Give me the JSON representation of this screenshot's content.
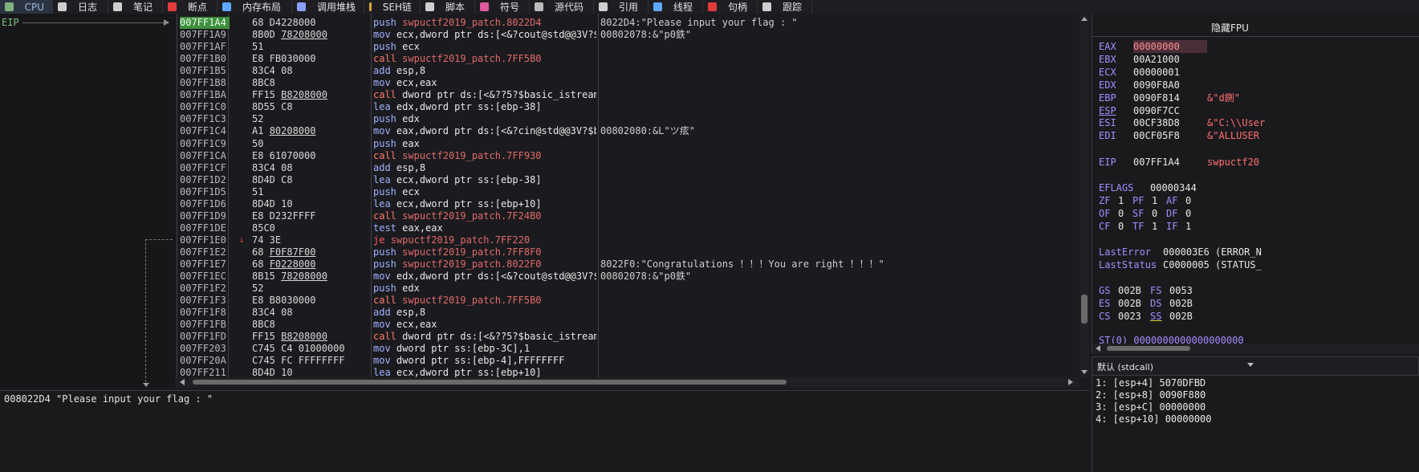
{
  "tabs": [
    {
      "label": "CPU",
      "icon": "cpu-icon",
      "color": "#7fb27f",
      "active": true
    },
    {
      "label": "日志",
      "icon": "log-icon",
      "color": "#cfcfcf"
    },
    {
      "label": "笔记",
      "icon": "notes-icon",
      "color": "#cfcfcf"
    },
    {
      "label": "断点",
      "icon": "breakpoint-icon",
      "color": "#e23b3b"
    },
    {
      "label": "内存布局",
      "icon": "memory-map-icon",
      "color": "#5fa8ff"
    },
    {
      "label": "调用堆栈",
      "icon": "call-stack-icon",
      "color": "#8aa0ff"
    },
    {
      "label": "SEH链",
      "icon": "seh-icon",
      "color": "#d9a63a"
    },
    {
      "label": "脚本",
      "icon": "script-icon",
      "color": "#cfcfcf"
    },
    {
      "label": "符号",
      "icon": "symbols-icon",
      "color": "#e05aa0"
    },
    {
      "label": "源代码",
      "icon": "source-icon",
      "color": "#bbbbbb"
    },
    {
      "label": "引用",
      "icon": "references-icon",
      "color": "#cfcfcf"
    },
    {
      "label": "线程",
      "icon": "threads-icon",
      "color": "#5fa8ff"
    },
    {
      "label": "句柄",
      "icon": "handles-icon",
      "color": "#e23b3b"
    },
    {
      "label": "跟踪",
      "icon": "trace-icon",
      "color": "#cfcfcf"
    }
  ],
  "gutter": {
    "eip_label": "EIP"
  },
  "disasm": [
    {
      "addr": "007FF1A4",
      "bytes": "68 D4228000",
      "mn": "push",
      "ops": "swpuctf2019_patch.8022D4",
      "cmt": "8022D4:\"Please input your flag : \"",
      "eip": true
    },
    {
      "addr": "007FF1A9",
      "bytes": "8B0D ",
      "bytes_u": "78208000",
      "mn": "mov",
      "ops": "ecx,dword ptr ds:[<&?cout@std@@3V?$ba",
      "cmt": "00802078:&\"p0鉄\""
    },
    {
      "addr": "007FF1AF",
      "bytes": "51",
      "mn": "push",
      "ops": "ecx"
    },
    {
      "addr": "007FF1B0",
      "bytes": "E8 FB030000",
      "mn": "call",
      "ops": "swpuctf2019_patch.7FF5B0"
    },
    {
      "addr": "007FF1B5",
      "bytes": "83C4 08",
      "mn": "add",
      "ops": "esp,8"
    },
    {
      "addr": "007FF1B8",
      "bytes": "8BC8",
      "mn": "mov",
      "ops": "ecx,eax"
    },
    {
      "addr": "007FF1BA",
      "bytes": "FF15 ",
      "bytes_u": "B8208000",
      "mn": "call",
      "ops": "dword ptr ds:[<&??5?$basic_istream@"
    },
    {
      "addr": "007FF1C0",
      "bytes": "8D55 C8",
      "mn": "lea",
      "ops": "edx,dword ptr ss:[ebp-38]"
    },
    {
      "addr": "007FF1C3",
      "bytes": "52",
      "mn": "push",
      "ops": "edx"
    },
    {
      "addr": "007FF1C4",
      "bytes": "A1 ",
      "bytes_u": "80208000",
      "mn": "mov",
      "ops": "eax,dword ptr ds:[<&?cin@std@@3V?$ba",
      "cmt": "00802080:&L\"ツ痃\""
    },
    {
      "addr": "007FF1C9",
      "bytes": "50",
      "mn": "push",
      "ops": "eax"
    },
    {
      "addr": "007FF1CA",
      "bytes": "E8 61070000",
      "mn": "call",
      "ops": "swpuctf2019_patch.7FF930"
    },
    {
      "addr": "007FF1CF",
      "bytes": "83C4 08",
      "mn": "add",
      "ops": "esp,8"
    },
    {
      "addr": "007FF1D2",
      "bytes": "8D4D C8",
      "mn": "lea",
      "ops": "ecx,dword ptr ss:[ebp-38]"
    },
    {
      "addr": "007FF1D5",
      "bytes": "51",
      "mn": "push",
      "ops": "ecx"
    },
    {
      "addr": "007FF1D6",
      "bytes": "8D4D 10",
      "mn": "lea",
      "ops": "ecx,dword ptr ss:[ebp+10]"
    },
    {
      "addr": "007FF1D9",
      "bytes": "E8 D232FFFF",
      "mn": "call",
      "ops": "swpuctf2019_patch.7F24B0"
    },
    {
      "addr": "007FF1DE",
      "bytes": "85C0",
      "mn": "test",
      "ops": "eax,eax"
    },
    {
      "addr": "007FF1E0",
      "bytes": "74 3E",
      "mn": "je",
      "ops": "swpuctf2019_patch.7FF220",
      "jump": true
    },
    {
      "addr": "007FF1E2",
      "bytes": "68 ",
      "bytes_u": "F0F87F00",
      "mn": "push",
      "ops": "swpuctf2019_patch.7FF8F0"
    },
    {
      "addr": "007FF1E7",
      "bytes": "68 ",
      "bytes_u": "F0228000",
      "mn": "push",
      "ops": "swpuctf2019_patch.8022F0",
      "cmt": "8022F0:\"Congratulations ！！！You are right ！！！\""
    },
    {
      "addr": "007FF1EC",
      "bytes": "8B15 ",
      "bytes_u": "78208000",
      "mn": "mov",
      "ops": "edx,dword ptr ds:[<&?cout@std@@3V?$ba",
      "cmt": "00802078:&\"p0鉄\""
    },
    {
      "addr": "007FF1F2",
      "bytes": "52",
      "mn": "push",
      "ops": "edx"
    },
    {
      "addr": "007FF1F3",
      "bytes": "E8 B8030000",
      "mn": "call",
      "ops": "swpuctf2019_patch.7FF5B0"
    },
    {
      "addr": "007FF1F8",
      "bytes": "83C4 08",
      "mn": "add",
      "ops": "esp,8"
    },
    {
      "addr": "007FF1FB",
      "bytes": "8BC8",
      "mn": "mov",
      "ops": "ecx,eax"
    },
    {
      "addr": "007FF1FD",
      "bytes": "FF15 ",
      "bytes_u": "B8208000",
      "mn": "call",
      "ops": "dword ptr ds:[<&??5?$basic_istream@"
    },
    {
      "addr": "007FF203",
      "bytes": "C745 C4 01000000",
      "mn": "mov",
      "ops": "dword ptr ss:[ebp-3C],1"
    },
    {
      "addr": "007FF20A",
      "bytes": "C745 FC FFFFFFFF",
      "mn": "mov",
      "ops": "dword ptr ss:[ebp-4],FFFFFFFF"
    },
    {
      "addr": "007FF211",
      "bytes": "8D4D 10",
      "mn": "lea",
      "ops": "ecx,dword ptr ss:[ebp+10]"
    }
  ],
  "info": {
    "text": "008022D4 \"Please input your flag : \""
  },
  "regs": {
    "hide_fpu": "隐藏FPU",
    "gp": [
      {
        "n": "EAX",
        "v": "00000000",
        "hl": true
      },
      {
        "n": "EBX",
        "v": "00A21000"
      },
      {
        "n": "ECX",
        "v": "00000001"
      },
      {
        "n": "EDX",
        "v": "0090F8A0"
      },
      {
        "n": "EBP",
        "v": "0090F814",
        "c": "&\"d鍘\""
      },
      {
        "n": "ESP",
        "v": "0090F7CC",
        "u": true
      },
      {
        "n": "ESI",
        "v": "00CF38D8",
        "c": "&\"C:\\\\User"
      },
      {
        "n": "EDI",
        "v": "00CF05F8",
        "c": "&\"ALLUSER"
      }
    ],
    "eip": {
      "n": "EIP",
      "v": "007FF1A4",
      "c": "swpuctf20"
    },
    "eflags": {
      "n": "EFLAGS",
      "v": "00000344"
    },
    "flags": [
      [
        {
          "n": "ZF",
          "v": "1"
        },
        {
          "n": "PF",
          "v": "1"
        },
        {
          "n": "AF",
          "v": "0"
        }
      ],
      [
        {
          "n": "OF",
          "v": "0"
        },
        {
          "n": "SF",
          "v": "0"
        },
        {
          "n": "DF",
          "v": "0"
        }
      ],
      [
        {
          "n": "CF",
          "v": "0"
        },
        {
          "n": "TF",
          "v": "1"
        },
        {
          "n": "IF",
          "v": "1"
        }
      ]
    ],
    "last_error": {
      "n": "LastError",
      "v": "000003E6 (ERROR_N"
    },
    "last_status": {
      "n": "LastStatus",
      "v": "C0000005 (STATUS_"
    },
    "segs": [
      [
        {
          "n": "GS",
          "v": "002B"
        },
        {
          "n": "FS",
          "v": "0053"
        }
      ],
      [
        {
          "n": "ES",
          "v": "002B"
        },
        {
          "n": "DS",
          "v": "002B"
        }
      ],
      [
        {
          "n": "CS",
          "v": "0023"
        },
        {
          "n": "SS",
          "v": "002B"
        }
      ]
    ],
    "st0": "ST(0) 0000000000000000000"
  },
  "callconv": {
    "label": "默认 (stdcall)"
  },
  "args": [
    "1: [esp+4] 5070DFBD",
    "2: [esp+8] 0090F880",
    "3: [esp+C] 00000000",
    "4: [esp+10] 00000000"
  ]
}
